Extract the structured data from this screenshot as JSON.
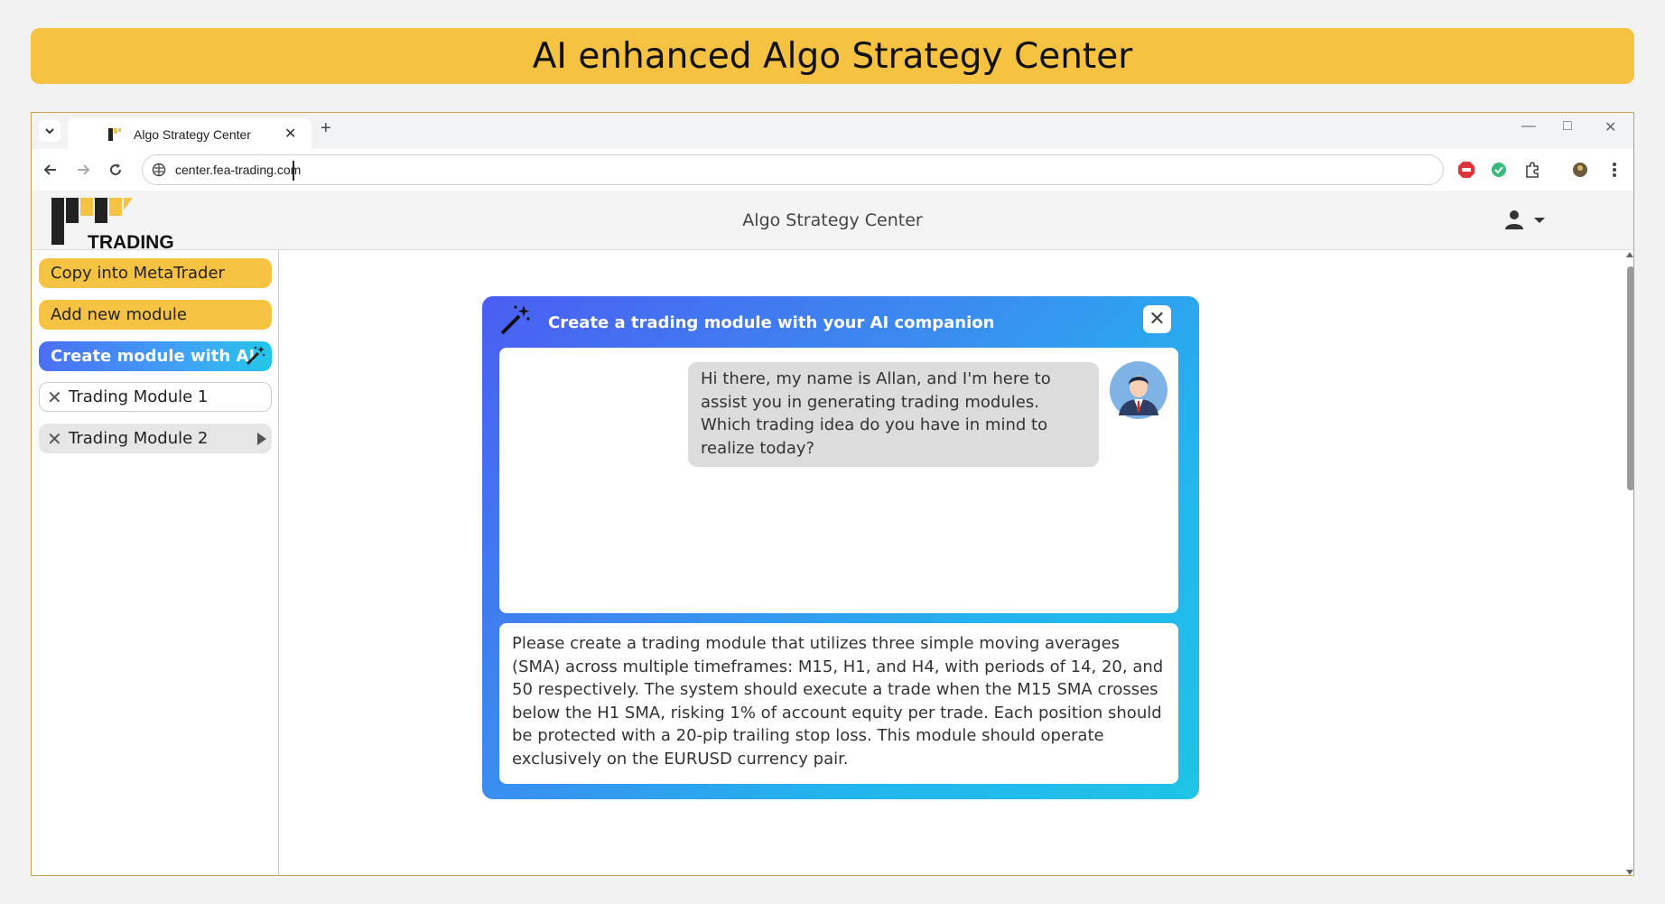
{
  "banner": {
    "title": "AI enhanced Algo Strategy Center"
  },
  "browser": {
    "tab": {
      "title": "Algo Strategy Center",
      "close_glyph": "✕"
    },
    "new_tab_glyph": "+",
    "window_controls": {
      "minimize": "—",
      "maximize": "□",
      "close": "✕"
    },
    "url": "center.fea-trading.com"
  },
  "app": {
    "logo_text": "TRADING",
    "title": "Algo Strategy Center"
  },
  "sidebar": {
    "copy_label": "Copy into MetaTrader",
    "add_label": "Add new module",
    "ai_label": "Create module with AI",
    "modules": [
      {
        "label": "Trading Module 1",
        "selected": false
      },
      {
        "label": "Trading Module 2",
        "selected": true
      }
    ]
  },
  "dialog": {
    "title": "Create a trading module with your AI companion",
    "close_glyph": "✕",
    "assistant_message": "Hi there, my name is Allan, and I'm here to assist you in generating trading modules. Which trading idea do you have in mind to realize today?",
    "user_input": "Please create a trading module that utilizes three simple moving averages (SMA) across multiple timeframes: M15, H1, and H4, with periods of 14, 20, and 50 respectively. The system should execute a trade when the M15 SMA crosses below the H1 SMA, risking 1% of account equity per trade. Each position should be protected with a 20-pip trailing stop loss. This module should operate exclusively on the EURUSD currency pair."
  },
  "colors": {
    "accent_yellow": "#f5c242",
    "gradient_start": "#4a5ef2",
    "gradient_end": "#1fc4e6"
  },
  "icons": [
    "chevron-down-icon",
    "favicon-icon",
    "back-icon",
    "forward-icon",
    "reload-icon",
    "site-info-icon",
    "adblock-icon",
    "green-extension-icon",
    "puzzle-icon",
    "profile-extension-icon",
    "kebab-menu-icon",
    "user-icon",
    "caret-down-icon",
    "magic-wand-icon",
    "avatar-icon",
    "play-right-icon"
  ]
}
